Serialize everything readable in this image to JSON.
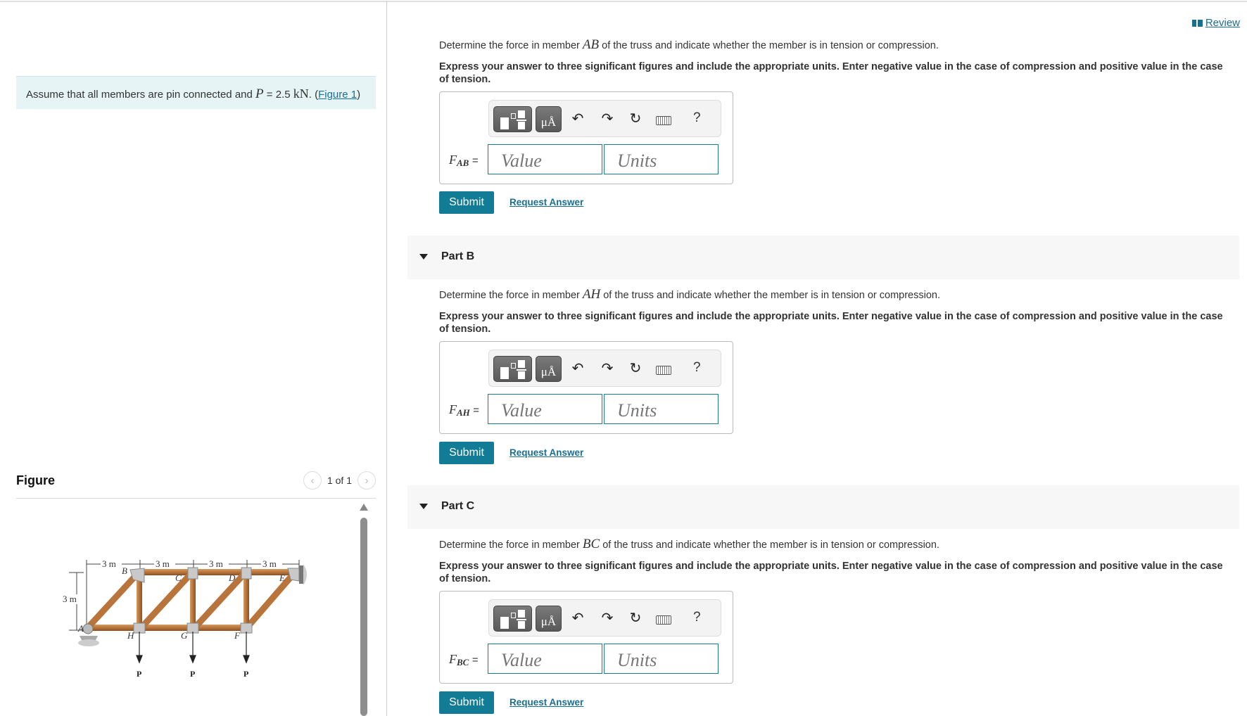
{
  "problem": {
    "text_before": "Assume that all members are pin connected and ",
    "var": "P",
    "eq": " = 2.5 ",
    "unit": "kN",
    "text_after": ". (",
    "figure_link": "Figure 1",
    "close": ")"
  },
  "figure": {
    "title": "Figure",
    "pager": "1 of 1",
    "prev_icon": "chevron-left-icon",
    "next_icon": "chevron-right-icon",
    "labels": {
      "dims": [
        "3 m",
        "3 m",
        "3 m",
        "3 m"
      ],
      "height": "3 m",
      "top_nodes": [
        "B",
        "C",
        "D",
        "E"
      ],
      "bottom_nodes": [
        "A",
        "H",
        "G",
        "F"
      ],
      "loads": [
        "P",
        "P",
        "P"
      ]
    }
  },
  "review": {
    "label": " Review",
    "icon": "book-icon"
  },
  "toolbar": {
    "template_icon": "fraction-template-icon",
    "units_label": "μÅ",
    "undo": "↶",
    "redo": "↷",
    "reset": "↻",
    "help": "?"
  },
  "parts": [
    {
      "id": "A",
      "header": "",
      "question_before": "Determine the force in member ",
      "member": "AB",
      "question_after": " of the truss and indicate whether the member is in tension or compression.",
      "instruction": "Express your answer to three significant figures and include the appropriate units. Enter negative value in the case of compression and positive value in the case of tension.",
      "var": "F",
      "sub": "AB",
      "value_placeholder": "Value",
      "units_placeholder": "Units",
      "submit": "Submit",
      "request": "Request Answer"
    },
    {
      "id": "B",
      "header": "Part B",
      "question_before": "Determine the force in member ",
      "member": "AH",
      "question_after": " of the truss and indicate whether the member is in tension or compression.",
      "instruction": "Express your answer to three significant figures and include the appropriate units. Enter negative value in the case of compression and positive value in the case of tension.",
      "var": "F",
      "sub": "AH",
      "value_placeholder": "Value",
      "units_placeholder": "Units",
      "submit": "Submit",
      "request": "Request Answer"
    },
    {
      "id": "C",
      "header": "Part C",
      "question_before": "Determine the force in member ",
      "member": "BC",
      "question_after": " of the truss and indicate whether the member is in tension or compression.",
      "instruction": "Express your answer to three significant figures and include the appropriate units. Enter negative value in the case of compression and positive value in the case of tension.",
      "var": "F",
      "sub": "BC",
      "value_placeholder": "Value",
      "units_placeholder": "Units",
      "submit": "Submit",
      "request": "Request Answer"
    }
  ]
}
